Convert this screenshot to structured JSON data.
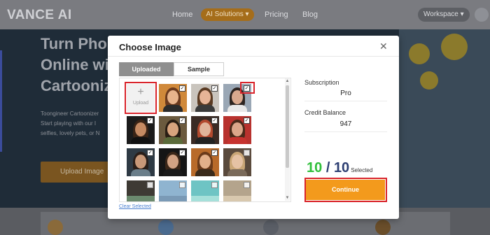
{
  "nav": {
    "logo": "VANCE AI",
    "links": [
      "Home",
      "AI Solutions",
      "Pricing",
      "Blog"
    ],
    "workspace": "Workspace"
  },
  "hero": {
    "title_lines": [
      "Turn Pho",
      "Online wi",
      "Cartooniz"
    ],
    "text_lines": [
      "Toongineer Cartoonizer",
      "Start playing with our I",
      "selfies, lovely pets, or N"
    ],
    "button": "Upload Image"
  },
  "modal": {
    "title": "Choose Image",
    "tabs": [
      "Uploaded",
      "Sample"
    ],
    "upload_label": "Upload",
    "clear_selected": "Clear Selected",
    "subscription_label": "Subscription",
    "subscription_value": "Pro",
    "credit_label": "Credit Balance",
    "credit_value": "947",
    "selected_count": "10",
    "selected_slash": "/",
    "selected_max": "10",
    "selected_word": "Selected",
    "continue_label": "Continue"
  },
  "colors": {
    "accent_orange": "#f39a1c",
    "count_green": "#2fbf3a",
    "count_navy": "#2c3e72",
    "highlight_red": "#d9242b"
  },
  "thumbnails": [
    {
      "row": 0,
      "col": 1,
      "checked": true
    },
    {
      "row": 0,
      "col": 2,
      "checked": true
    },
    {
      "row": 0,
      "col": 3,
      "checked": true
    },
    {
      "row": 1,
      "col": 0,
      "checked": true
    },
    {
      "row": 1,
      "col": 1,
      "checked": true
    },
    {
      "row": 1,
      "col": 2,
      "checked": true
    },
    {
      "row": 1,
      "col": 3,
      "checked": true
    },
    {
      "row": 2,
      "col": 0,
      "checked": true
    },
    {
      "row": 2,
      "col": 1,
      "checked": true
    },
    {
      "row": 2,
      "col": 2,
      "checked": true
    },
    {
      "row": 2,
      "col": 3,
      "checked": false
    },
    {
      "row": 3,
      "col": 0,
      "checked": false
    },
    {
      "row": 3,
      "col": 1,
      "checked": false
    },
    {
      "row": 3,
      "col": 2,
      "checked": false
    },
    {
      "row": 3,
      "col": 3,
      "checked": false
    }
  ]
}
